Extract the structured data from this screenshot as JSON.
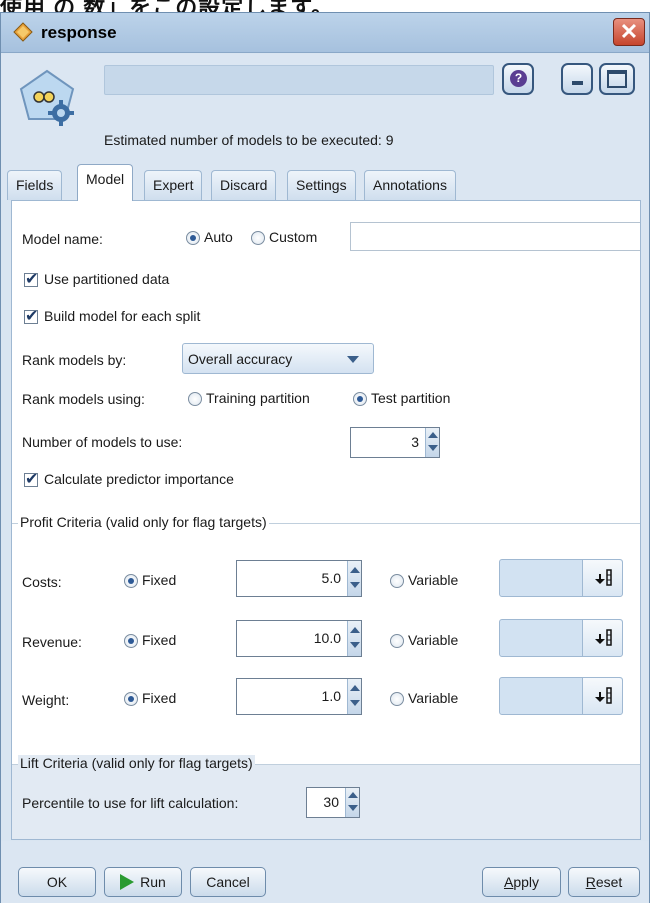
{
  "window": {
    "title": "response",
    "top_text": "使用 の 数」をこの設定します。"
  },
  "header": {
    "estimate_text": "Estimated number of models to be executed: 9",
    "node_name": ""
  },
  "tabs": [
    {
      "label": "Fields"
    },
    {
      "label": "Model"
    },
    {
      "label": "Expert"
    },
    {
      "label": "Discard"
    },
    {
      "label": "Settings"
    },
    {
      "label": "Annotations"
    }
  ],
  "active_tab": "Model",
  "model": {
    "model_name_label": "Model name:",
    "auto_label": "Auto",
    "custom_label": "Custom",
    "custom_value": "",
    "use_partitioned_label": "Use partitioned data",
    "build_each_split_label": "Build model for each split",
    "rank_by_label": "Rank models by:",
    "rank_by_value": "Overall accuracy",
    "rank_using_label": "Rank models using:",
    "training_partition_label": "Training partition",
    "test_partition_label": "Test partition",
    "num_models_label": "Number of models to use:",
    "num_models_value": "3",
    "calc_importance_label": "Calculate predictor importance"
  },
  "profit": {
    "group_label": "Profit Criteria (valid only for flag targets)",
    "fixed_label": "Fixed",
    "variable_label": "Variable",
    "rows": [
      {
        "label": "Costs:",
        "value": "5.0"
      },
      {
        "label": "Revenue:",
        "value": "10.0"
      },
      {
        "label": "Weight:",
        "value": "1.0"
      }
    ]
  },
  "lift": {
    "group_label": "Lift Criteria (valid only for flag targets)",
    "percentile_label": "Percentile to use for lift calculation:",
    "percentile_value": "30"
  },
  "footer": {
    "ok": "OK",
    "run": "Run",
    "cancel": "Cancel",
    "apply_prefix": "A",
    "apply_rest": "pply",
    "reset_prefix": "R",
    "reset_rest": "eset"
  },
  "colors": {
    "accent": "#2e5a96",
    "run_green": "#2a9b32",
    "close_red": "#c6452d"
  }
}
